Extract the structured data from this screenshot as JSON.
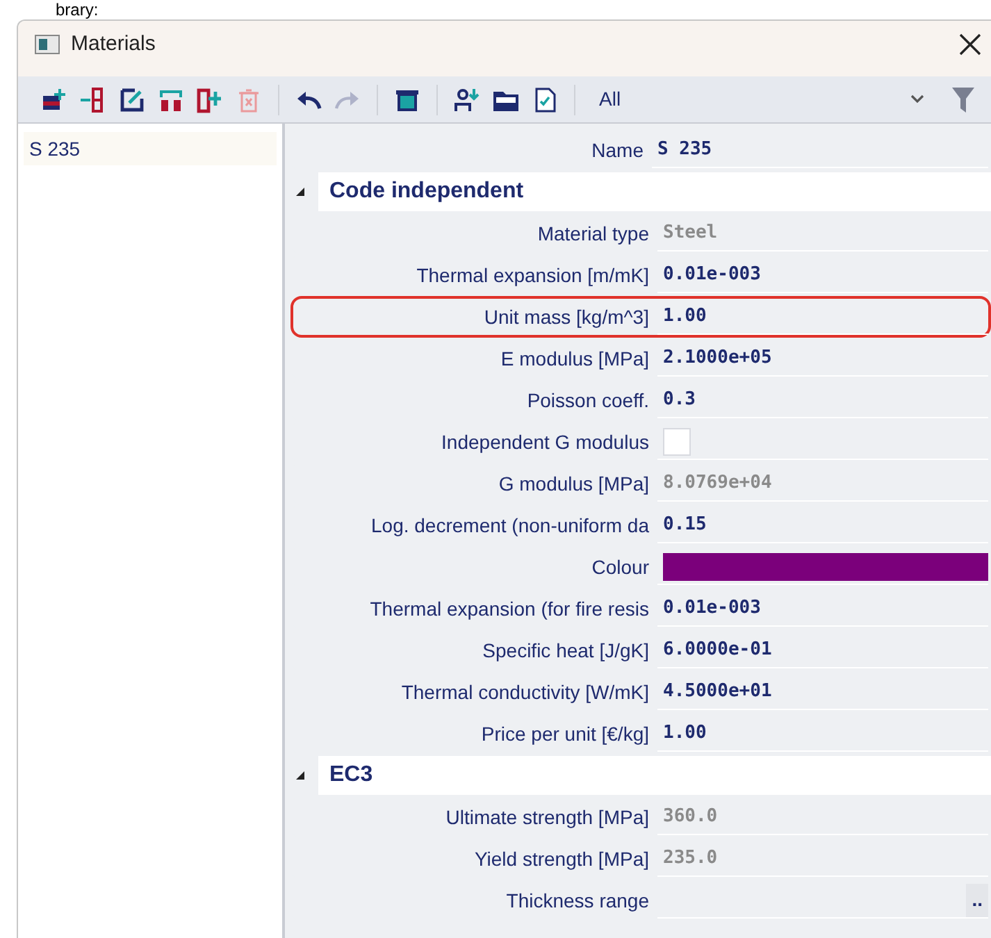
{
  "caption_fragment": "brary:",
  "window": {
    "title": "Materials"
  },
  "toolbar": {
    "buttons": [
      {
        "kind": "add",
        "disabled": false
      },
      {
        "kind": "insert",
        "disabled": false
      },
      {
        "kind": "edit",
        "disabled": false
      },
      {
        "kind": "duplicate",
        "disabled": false
      },
      {
        "kind": "add-column",
        "disabled": false
      },
      {
        "kind": "delete",
        "disabled": true
      },
      {
        "kind": "undo",
        "disabled": false
      },
      {
        "kind": "redo",
        "disabled": true
      },
      {
        "kind": "archive",
        "disabled": false
      },
      {
        "kind": "add-user",
        "disabled": false
      },
      {
        "kind": "folder",
        "disabled": false
      },
      {
        "kind": "checklist",
        "disabled": false
      }
    ],
    "filter": {
      "value": "All"
    }
  },
  "sidebar": {
    "items": [
      {
        "label": "S 235",
        "selected": true
      }
    ]
  },
  "properties": {
    "name_row": {
      "label": "Name",
      "value": "S 235"
    },
    "groups": [
      {
        "title": "Code independent",
        "expanded": true,
        "rows": [
          {
            "kind": "text",
            "label": "Material type",
            "value": "Steel",
            "readonly": true,
            "highlighted": false
          },
          {
            "kind": "text",
            "label": "Thermal expansion  [m/mK]",
            "value": "0.01e-003",
            "readonly": false,
            "highlighted": false
          },
          {
            "kind": "text",
            "label": "Unit mass [kg/m^3]",
            "value": "1.00",
            "readonly": false,
            "highlighted": true
          },
          {
            "kind": "text",
            "label": "E modulus [MPa]",
            "value": "2.1000e+05",
            "readonly": false,
            "highlighted": false
          },
          {
            "kind": "text",
            "label": "Poisson coeff.",
            "value": "0.3",
            "readonly": false,
            "highlighted": false
          },
          {
            "kind": "checkbox",
            "label": "Independent G modulus",
            "checked": false,
            "highlighted": false
          },
          {
            "kind": "text",
            "label": "G modulus [MPa]",
            "value": "8.0769e+04",
            "readonly": true,
            "highlighted": false
          },
          {
            "kind": "text",
            "label": "Log. decrement (non-uniform da",
            "value": "0.15",
            "readonly": false,
            "highlighted": false
          },
          {
            "kind": "color",
            "label": "Colour",
            "color": "#7b007b",
            "highlighted": false
          },
          {
            "kind": "text",
            "label": "Thermal expansion (for fire resis",
            "value": "0.01e-003",
            "readonly": false,
            "highlighted": false
          },
          {
            "kind": "text",
            "label": "Specific heat [J/gK]",
            "value": "6.0000e-01",
            "readonly": false,
            "highlighted": false
          },
          {
            "kind": "text",
            "label": "Thermal conductivity [W/mK]",
            "value": "4.5000e+01",
            "readonly": false,
            "highlighted": false
          },
          {
            "kind": "text",
            "label": "Price per unit [€/kg]",
            "value": "1.00",
            "readonly": false,
            "highlighted": false
          }
        ]
      },
      {
        "title": "EC3",
        "expanded": true,
        "rows": [
          {
            "kind": "text",
            "label": "Ultimate strength [MPa]",
            "value": "360.0",
            "readonly": true,
            "highlighted": false
          },
          {
            "kind": "text",
            "label": "Yield strength [MPa]",
            "value": "235.0",
            "readonly": true,
            "highlighted": false
          },
          {
            "kind": "button",
            "label": "Thickness range",
            "button": "..",
            "highlighted": false
          }
        ]
      }
    ]
  }
}
